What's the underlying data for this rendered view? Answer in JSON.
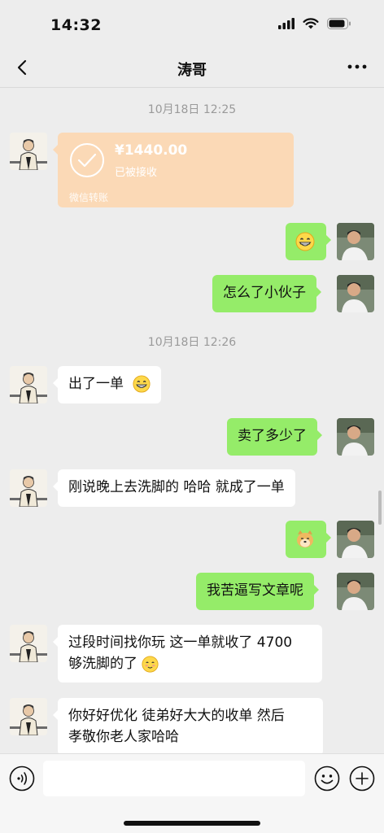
{
  "status_bar": {
    "time": "14:32"
  },
  "header": {
    "title": "涛哥"
  },
  "messages": {
    "ts1": "10月18日 12:25",
    "transfer": {
      "amount": "¥1440.00",
      "status": "已被接收",
      "label": "微信转账"
    },
    "m2": "怎么了小伙子",
    "ts2": "10月18日 12:26",
    "m3": "出了一单",
    "m4": "卖了多少了",
    "m5": "刚说晚上去洗脚的 哈哈 就成了一单",
    "m6": "我苦逼写文章呢",
    "m7_line1": "过段时间找你玩 这一单就收了 4700",
    "m7_line2": "够洗脚的了",
    "m8_line1": "你好好优化  徒弟好大大的收单 然后",
    "m8_line2": "孝敬你老人家哈哈"
  },
  "colors": {
    "sent_bubble": "#95ec69",
    "received_bubble": "#ffffff",
    "transfer_bubble": "#fbd9b6",
    "background": "#ededed"
  }
}
